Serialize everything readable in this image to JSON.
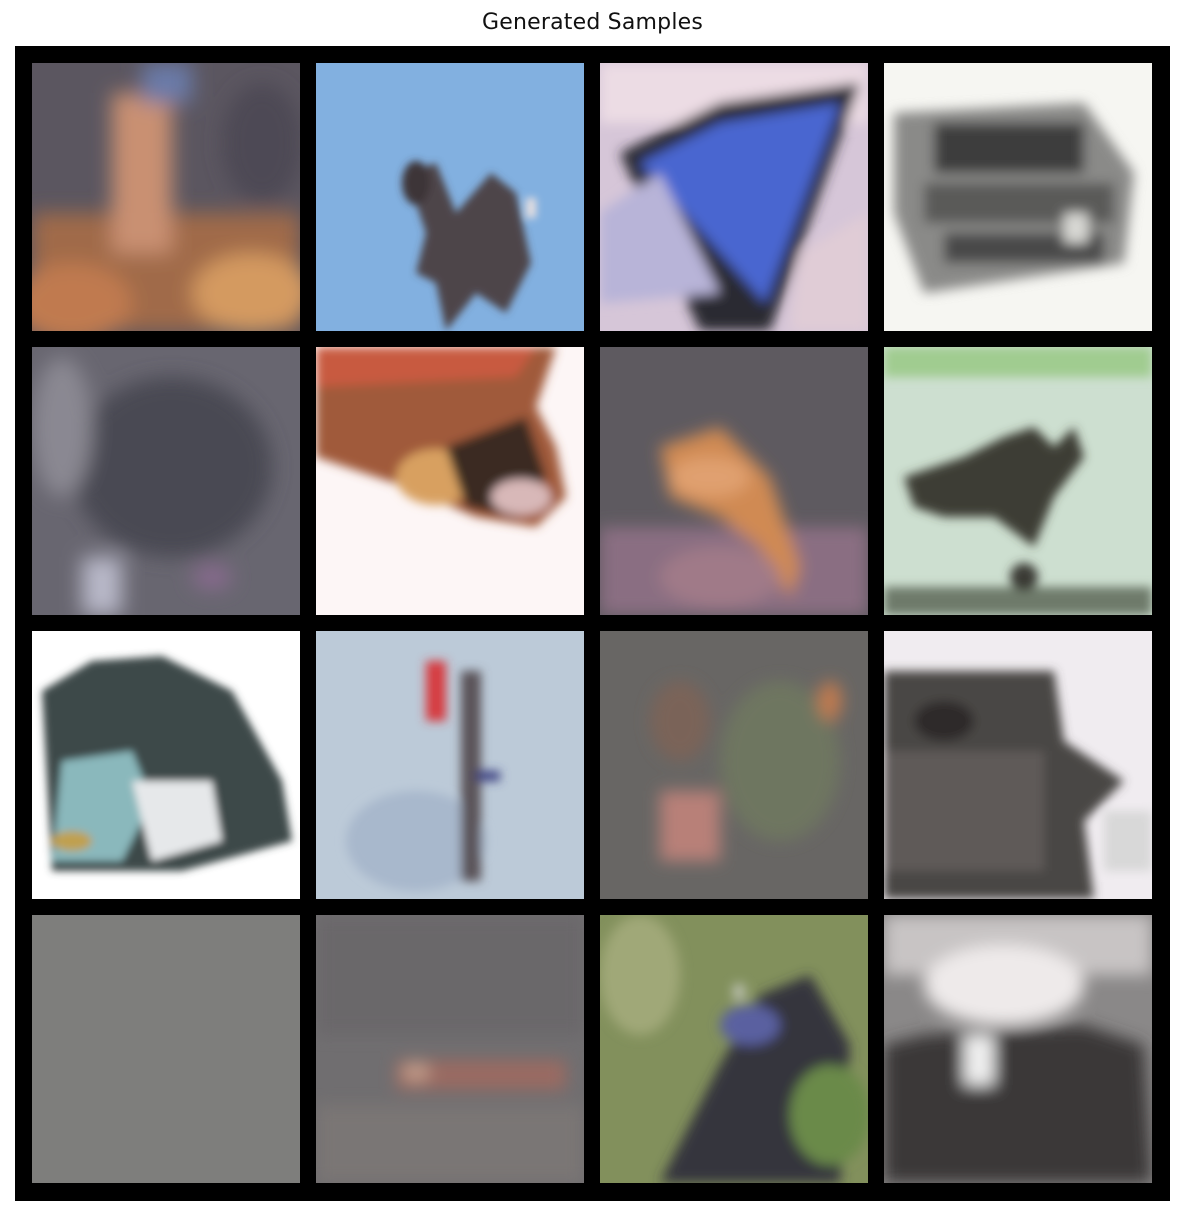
{
  "title": "Generated Samples",
  "grid": {
    "rows": 4,
    "cols": 4,
    "border_color": "#000000"
  },
  "samples": [
    {
      "row": 0,
      "col": 0,
      "content": "warm orange blurred figure on dark background",
      "colors": [
        "#5b5660",
        "#c78a5a",
        "#e0a070",
        "#7a6a7a"
      ]
    },
    {
      "row": 0,
      "col": 1,
      "content": "dark bird-like shape against blue sky",
      "colors": [
        "#7fb0e0",
        "#4a3f45"
      ]
    },
    {
      "row": 0,
      "col": 2,
      "content": "blue triangular shape with dark edges on lavender",
      "colors": [
        "#d7c8d8",
        "#4a68d0",
        "#2a2a30"
      ]
    },
    {
      "row": 0,
      "col": 3,
      "content": "grey vehicle shape on white",
      "colors": [
        "#f4f4f0",
        "#6a6a6a",
        "#3a3a3a"
      ]
    },
    {
      "row": 1,
      "col": 0,
      "content": "dark grey murky texture",
      "colors": [
        "#6a6870",
        "#4a4850",
        "#8a8890"
      ]
    },
    {
      "row": 1,
      "col": 1,
      "content": "brown and orange animal head on white",
      "colors": [
        "#fdf7f7",
        "#a0603a",
        "#3a2a22",
        "#d89a60"
      ]
    },
    {
      "row": 1,
      "col": 2,
      "content": "orange animal on dark and pink background",
      "colors": [
        "#5e5a60",
        "#d88a50",
        "#8a7080"
      ]
    },
    {
      "row": 1,
      "col": 3,
      "content": "dark bird shape on pale green background",
      "colors": [
        "#cfe0d0",
        "#3a3a30",
        "#9ac890"
      ]
    },
    {
      "row": 2,
      "col": 0,
      "content": "dark rounded object with teal and white on white",
      "colors": [
        "#ffffff",
        "#3a4a48",
        "#8abcc0",
        "#e0e0e0"
      ]
    },
    {
      "row": 2,
      "col": 1,
      "content": "thin red and dark vertical shape on pale blue",
      "colors": [
        "#b8c8d8",
        "#d83a40",
        "#3a3a48"
      ]
    },
    {
      "row": 2,
      "col": 2,
      "content": "muted green blob with pink on grey",
      "colors": [
        "#6a6866",
        "#7a8060",
        "#c08070"
      ]
    },
    {
      "row": 2,
      "col": 3,
      "content": "dark cluttered object on white",
      "colors": [
        "#f0ecf0",
        "#3e3a38",
        "#8a8a88"
      ]
    },
    {
      "row": 3,
      "col": 0,
      "content": "flat uniform grey",
      "colors": [
        "#7e7e7c"
      ]
    },
    {
      "row": 3,
      "col": 1,
      "content": "grey with faint red streak",
      "colors": [
        "#706e70",
        "#b0605a"
      ]
    },
    {
      "row": 3,
      "col": 2,
      "content": "green foliage with dark blue and black shape",
      "colors": [
        "#80905a",
        "#3a3848",
        "#5a60a0",
        "#a0b070"
      ]
    },
    {
      "row": 3,
      "col": 3,
      "content": "white and dark grey blurred object",
      "colors": [
        "#e0dcdc",
        "#2e2c2e",
        "#8a8888"
      ]
    }
  ]
}
